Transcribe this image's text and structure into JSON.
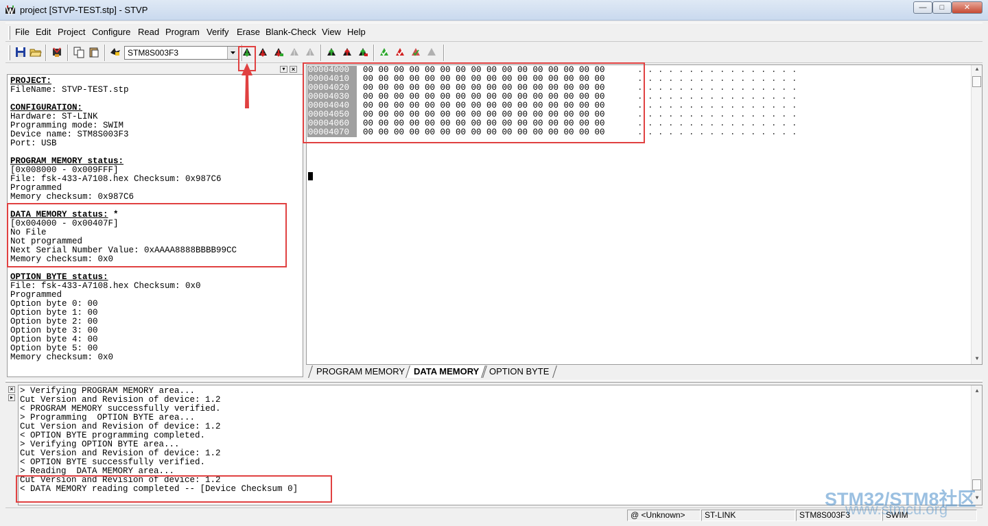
{
  "window": {
    "title": "project [STVP-TEST.stp] - STVP",
    "minimize": "—",
    "maximize": "□",
    "close": "✕"
  },
  "menu": [
    "File",
    "Edit",
    "Project",
    "Configure",
    "Read",
    "Program",
    "Verify",
    "Erase",
    "Blank-Check",
    "View",
    "Help"
  ],
  "toolbar": {
    "device": "STM8S003F3",
    "icons": [
      "save-icon",
      "open-icon",
      "chip-icon",
      "copy-icon",
      "paste-icon",
      "read-chip-icon",
      "read-current-tab-icon",
      "read-all-icon",
      "program-current-tab-icon",
      "program-all-icon",
      "verify-icon",
      "erase-icon",
      "blank-check-icon"
    ]
  },
  "info_panel": {
    "lines": [
      {
        "text": "PROJECT:",
        "head": true
      },
      {
        "text": "FileName: STVP-TEST.stp"
      },
      {
        "text": ""
      },
      {
        "text": "CONFIGURATION:",
        "head": true
      },
      {
        "text": "Hardware: ST-LINK"
      },
      {
        "text": "Programming mode: SWIM"
      },
      {
        "text": "Device name: STM8S003F3"
      },
      {
        "text": "Port: USB"
      },
      {
        "text": ""
      },
      {
        "text": "PROGRAM MEMORY status:",
        "head": true
      },
      {
        "text": "[0x008000 - 0x009FFF]"
      },
      {
        "text": "File: fsk-433-A7108.hex Checksum: 0x987C6"
      },
      {
        "text": "Programmed"
      },
      {
        "text": "Memory checksum: 0x987C6"
      },
      {
        "text": ""
      },
      {
        "text": "DATA MEMORY status:",
        "head": true,
        "suffix": " *"
      },
      {
        "text": "[0x004000 - 0x00407F]"
      },
      {
        "text": "No File"
      },
      {
        "text": "Not programmed"
      },
      {
        "text": "Next Serial Number Value: 0xAAAA8888BBBB99CC"
      },
      {
        "text": "Memory checksum: 0x0"
      },
      {
        "text": ""
      },
      {
        "text": "OPTION BYTE status:",
        "head": true
      },
      {
        "text": "File: fsk-433-A7108.hex Checksum: 0x0"
      },
      {
        "text": "Programmed"
      },
      {
        "text": "Option byte 0: 00"
      },
      {
        "text": "Option byte 1: 00"
      },
      {
        "text": "Option byte 2: 00"
      },
      {
        "text": "Option byte 3: 00"
      },
      {
        "text": "Option byte 4: 00"
      },
      {
        "text": "Option byte 5: 00"
      },
      {
        "text": "Memory checksum: 0x0"
      }
    ]
  },
  "hex_rows": [
    {
      "addr": "00004000",
      "bytes": "00 00 00 00 00 00 00 00 00 00 00 00 00 00 00 00",
      "ascii": ". . . . . . . . . . . . . . . ."
    },
    {
      "addr": "00004010",
      "bytes": "00 00 00 00 00 00 00 00 00 00 00 00 00 00 00 00",
      "ascii": ". . . . . . . . . . . . . . . ."
    },
    {
      "addr": "00004020",
      "bytes": "00 00 00 00 00 00 00 00 00 00 00 00 00 00 00 00",
      "ascii": ". . . . . . . . . . . . . . . ."
    },
    {
      "addr": "00004030",
      "bytes": "00 00 00 00 00 00 00 00 00 00 00 00 00 00 00 00",
      "ascii": ". . . . . . . . . . . . . . . ."
    },
    {
      "addr": "00004040",
      "bytes": "00 00 00 00 00 00 00 00 00 00 00 00 00 00 00 00",
      "ascii": ". . . . . . . . . . . . . . . ."
    },
    {
      "addr": "00004050",
      "bytes": "00 00 00 00 00 00 00 00 00 00 00 00 00 00 00 00",
      "ascii": ". . . . . . . . . . . . . . . ."
    },
    {
      "addr": "00004060",
      "bytes": "00 00 00 00 00 00 00 00 00 00 00 00 00 00 00 00",
      "ascii": ". . . . . . . . . . . . . . . ."
    },
    {
      "addr": "00004070",
      "bytes": "00 00 00 00 00 00 00 00 00 00 00 00 00 00 00 00",
      "ascii": ". . . . . . . . . . . . . . . ."
    }
  ],
  "tabs": [
    {
      "label": "PROGRAM MEMORY",
      "active": false
    },
    {
      "label": "DATA MEMORY",
      "active": true
    },
    {
      "label": "OPTION BYTE",
      "active": false
    }
  ],
  "log_lines": [
    "> Verifying PROGRAM MEMORY area...",
    "Cut Version and Revision of device: 1.2",
    "< PROGRAM MEMORY successfully verified.",
    "> Programming  OPTION BYTE area...",
    "Cut Version and Revision of device: 1.2",
    "< OPTION BYTE programming completed.",
    "> Verifying OPTION BYTE area...",
    "Cut Version and Revision of device: 1.2",
    "< OPTION BYTE successfully verified.",
    "> Reading  DATA MEMORY area...",
    "Cut Version and Revision of device: 1.2",
    "< DATA MEMORY reading completed -- [Device Checksum 0]"
  ],
  "status": {
    "address": "@ <Unknown>",
    "hardware": "ST-LINK",
    "device": "STM8S003F3",
    "mode": "SWIM"
  },
  "watermark": {
    "brand": "STM32/STM8社区",
    "url": "www.stmcu.org"
  },
  "colors": {
    "annotation": "#e04040",
    "address_bg": "#a0a0a0",
    "watermark": "#488cc8"
  }
}
